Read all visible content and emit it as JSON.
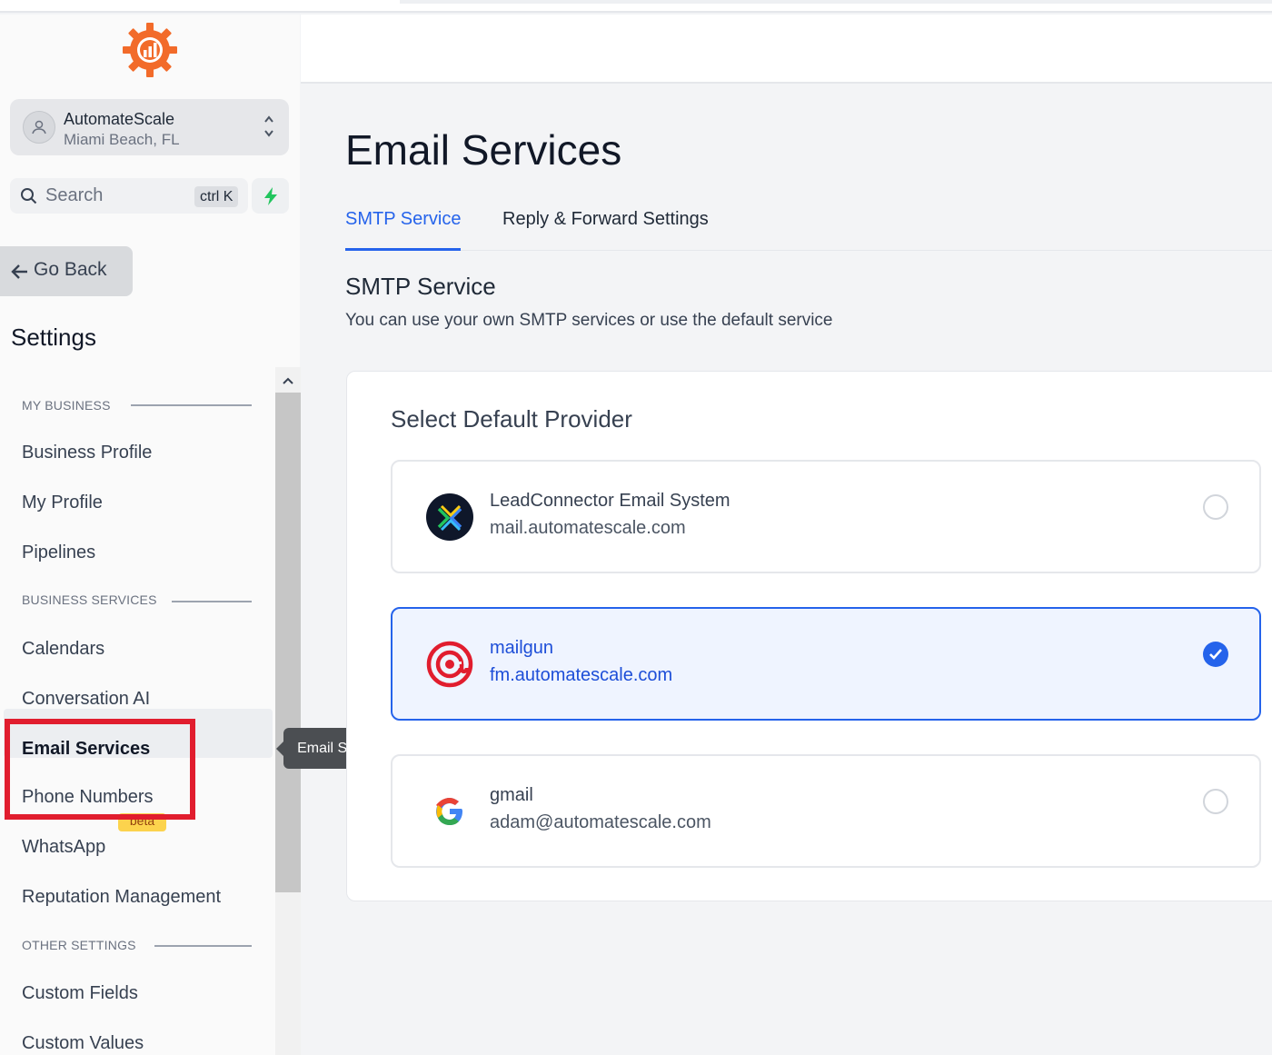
{
  "account": {
    "name": "AutomateScale",
    "location": "Miami Beach, FL"
  },
  "search": {
    "label": "Search",
    "shortcut": "ctrl K"
  },
  "nav": {
    "go_back": "Go Back",
    "settings_title": "Settings",
    "sections": {
      "my_business": "MY BUSINESS",
      "business_services": "BUSINESS SERVICES",
      "other_settings": "OTHER SETTINGS"
    },
    "items": {
      "business_profile": "Business Profile",
      "my_profile": "My Profile",
      "pipelines": "Pipelines",
      "calendars": "Calendars",
      "conversation_ai": "Conversation AI",
      "email_services": "Email Services",
      "phone_numbers": "Phone Numbers",
      "whatsapp": "WhatsApp",
      "whatsapp_badge": "beta",
      "reputation_management": "Reputation Management",
      "custom_fields": "Custom Fields",
      "custom_values": "Custom Values"
    },
    "active_item": "Email Services"
  },
  "tooltip": "Email Services",
  "main": {
    "title": "Email Services",
    "tabs": [
      {
        "label": "SMTP Service",
        "active": true
      },
      {
        "label": "Reply & Forward Settings",
        "active": false
      }
    ],
    "section_title": "SMTP Service",
    "section_subtitle": "You can use your own SMTP services or use the default service",
    "card_title": "Select Default Provider",
    "providers": [
      {
        "name": "LeadConnector Email System",
        "host": "mail.automatescale.com",
        "selected": false,
        "icon": "leadconnector-icon"
      },
      {
        "name": "mailgun",
        "host": "fm.automatescale.com",
        "selected": true,
        "icon": "mailgun-icon"
      },
      {
        "name": "gmail",
        "host": "adam@automatescale.com",
        "selected": false,
        "icon": "google-icon"
      }
    ]
  },
  "colors": {
    "accent": "#2563eb",
    "logo_orange": "#f26b2a",
    "highlight_red": "#e11d2e",
    "beta_badge": "#fcd34d"
  }
}
